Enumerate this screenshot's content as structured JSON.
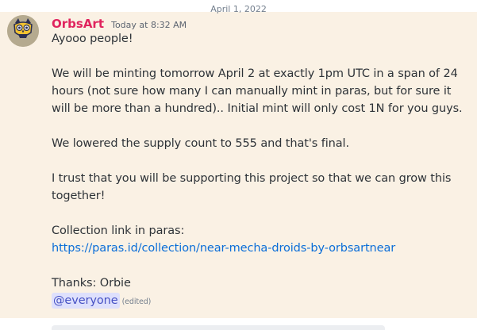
{
  "divider": {
    "date": "April 1, 2022"
  },
  "message": {
    "author": "OrbsArt",
    "timestamp": "Today at 8:32 AM",
    "avatar_icon": "orb-owl-avatar-icon",
    "lines": [
      "Ayooo people!",
      "We will be minting tomorrow April 2 at exactly 1pm UTC in a span of 24 hours (not sure how many I can manually mint in paras, but for sure it will be more than a hundred).. Initial mint will only cost 1N for you guys.",
      "We lowered the supply count to 555 and that's final.",
      "I trust that you will be supporting this project so that we can grow this together!",
      "Collection link in paras:"
    ],
    "link": "https://paras.id/collection/near-mecha-droids-by-orbsartnear",
    "signoff": "Thanks: Orbie",
    "mention": "@everyone",
    "edited": "(edited)"
  },
  "colors": {
    "username": "#e0245e",
    "highlight_background": "#faf1e4",
    "link": "#0b6ed8",
    "mention_bg": "#dee0fc",
    "mention_text": "#4752c4"
  }
}
